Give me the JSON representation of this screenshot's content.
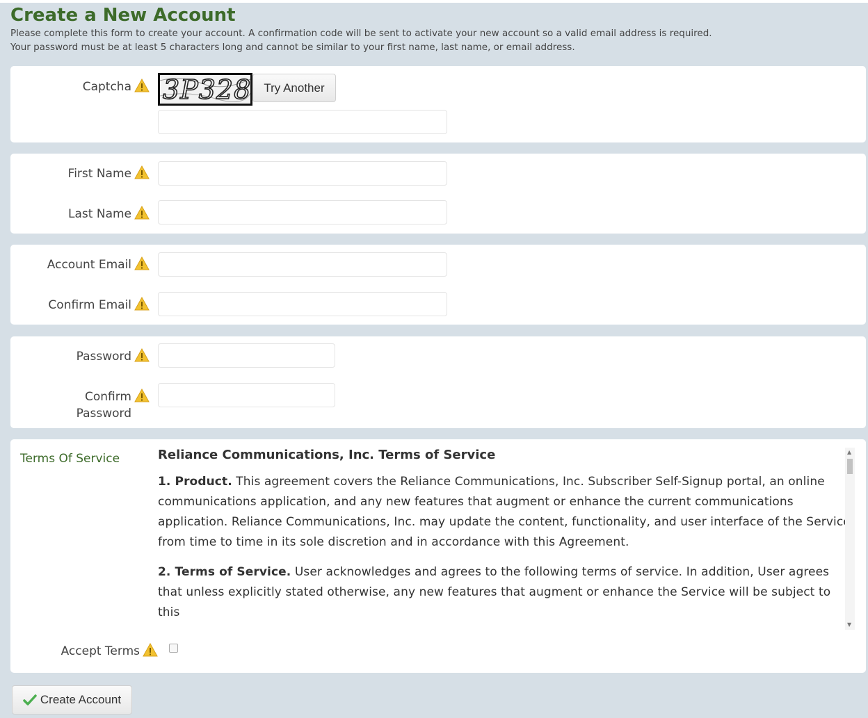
{
  "page": {
    "title": "Create a New Account",
    "intro_line1": "Please complete this form to create your account. A confirmation code will be sent to activate your new account so a valid email address is required.",
    "intro_line2": "Your password must be at least 5 characters long and cannot be similar to your first name, last name, or email address."
  },
  "captcha": {
    "label": "Captcha",
    "image_text": "3P328",
    "try_another_label": "Try Another",
    "input_value": ""
  },
  "name": {
    "first_label": "First Name",
    "first_value": "",
    "last_label": "Last Name",
    "last_value": ""
  },
  "email": {
    "account_label": "Account Email",
    "account_value": "",
    "confirm_label": "Confirm Email",
    "confirm_value": ""
  },
  "password": {
    "label": "Password",
    "confirm_label_line1": "Confirm",
    "confirm_label_line2": "Password"
  },
  "terms": {
    "label": "Terms Of Service",
    "heading": "Reliance Communications, Inc. Terms of Service",
    "p1_title": "1. Product.",
    "p1_text": " This agreement covers the Reliance Communications, Inc. Subscriber Self-Signup portal, an online communications application, and any new features that augment or enhance the current communications application. Reliance Communications, Inc. may update the content, functionality, and user interface of the Service from time to time in its sole discretion and in accordance with this Agreement.",
    "p2_title": "2. Terms of Service.",
    "p2_text": " User acknowledges and agrees to the following terms of service. In addition, User agrees that unless explicitly stated otherwise, any new features that augment or enhance the Service will be subject to this",
    "accept_label": "Accept Terms",
    "accepted": false
  },
  "actions": {
    "create_label": "Create Account"
  },
  "colors": {
    "title_green": "#3d6b2a",
    "warning_yellow": "#f2c230",
    "background": "#d6dfe6",
    "check_green": "#4caf50"
  },
  "icons": {
    "warning": "warning-icon",
    "check": "check-icon"
  }
}
